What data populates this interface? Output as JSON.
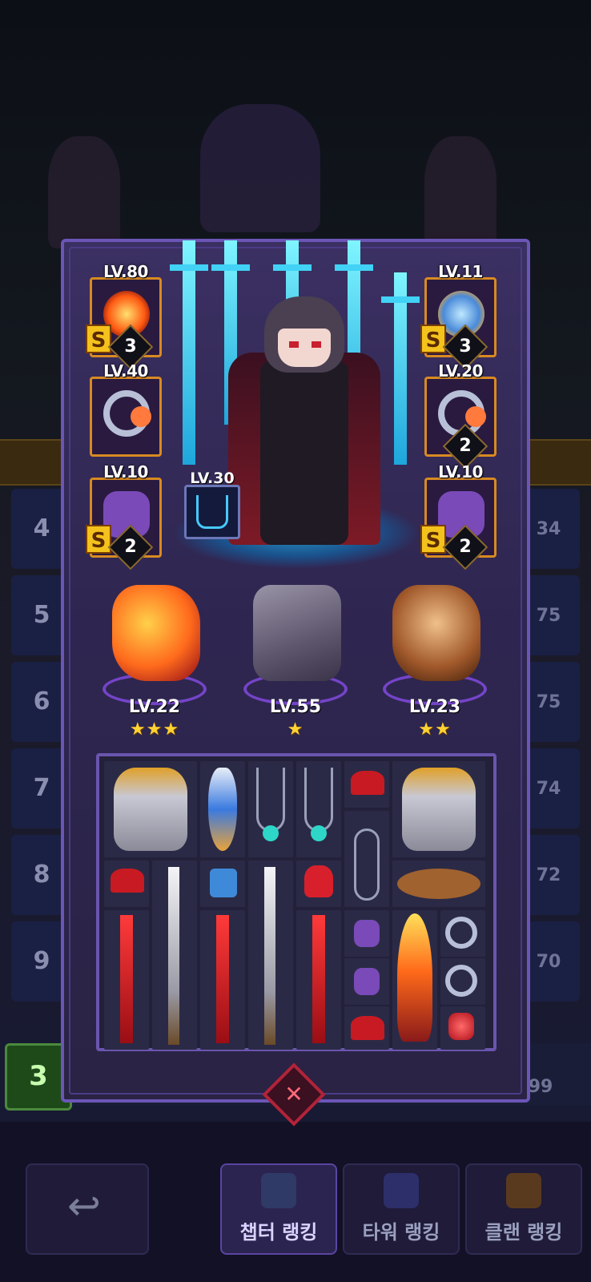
{
  "background": {
    "ranks": [
      "4",
      "5",
      "6",
      "7",
      "8",
      "9"
    ],
    "scores": [
      "34",
      "75",
      "75",
      "74",
      "72",
      "70"
    ],
    "my_rank": "3",
    "my_score": "99"
  },
  "equipment_left": [
    {
      "level": "LV.80",
      "grade": "S",
      "count": "3",
      "icon": "fire-orb-icon"
    },
    {
      "level": "LV.40",
      "grade": "",
      "count": "",
      "icon": "ring-icon"
    },
    {
      "level": "LV.10",
      "grade": "S",
      "count": "2",
      "icon": "purple-gauntlet-icon"
    }
  ],
  "equipment_right": [
    {
      "level": "LV.11",
      "grade": "S",
      "count": "3",
      "icon": "crystal-shield-icon"
    },
    {
      "level": "LV.20",
      "grade": "",
      "count": "2",
      "icon": "ring-icon"
    },
    {
      "level": "LV.10",
      "grade": "S",
      "count": "2",
      "icon": "purple-gauntlet-icon"
    }
  ],
  "skill": {
    "level": "LV.30",
    "icon": "sword-summon-icon"
  },
  "pets": [
    {
      "level": "LV.22",
      "stars": "★★★",
      "icon": "fire-fox-icon"
    },
    {
      "level": "LV.55",
      "stars": "★",
      "icon": "cannon-icon"
    },
    {
      "level": "LV.23",
      "stars": "★★",
      "icon": "warrior-pet-icon"
    }
  ],
  "bottom_nav": {
    "back_icon": "back-arrow-icon",
    "tabs": [
      {
        "label": "챕터 랭킹",
        "active": true
      },
      {
        "label": "타워 랭킹",
        "active": false
      },
      {
        "label": "클랜 랭킹",
        "active": false
      }
    ]
  },
  "colors": {
    "frame": "#6b56b8",
    "slot_border": "#d88a22",
    "grade_badge": "#f4c21c",
    "close": "#b0243a"
  }
}
